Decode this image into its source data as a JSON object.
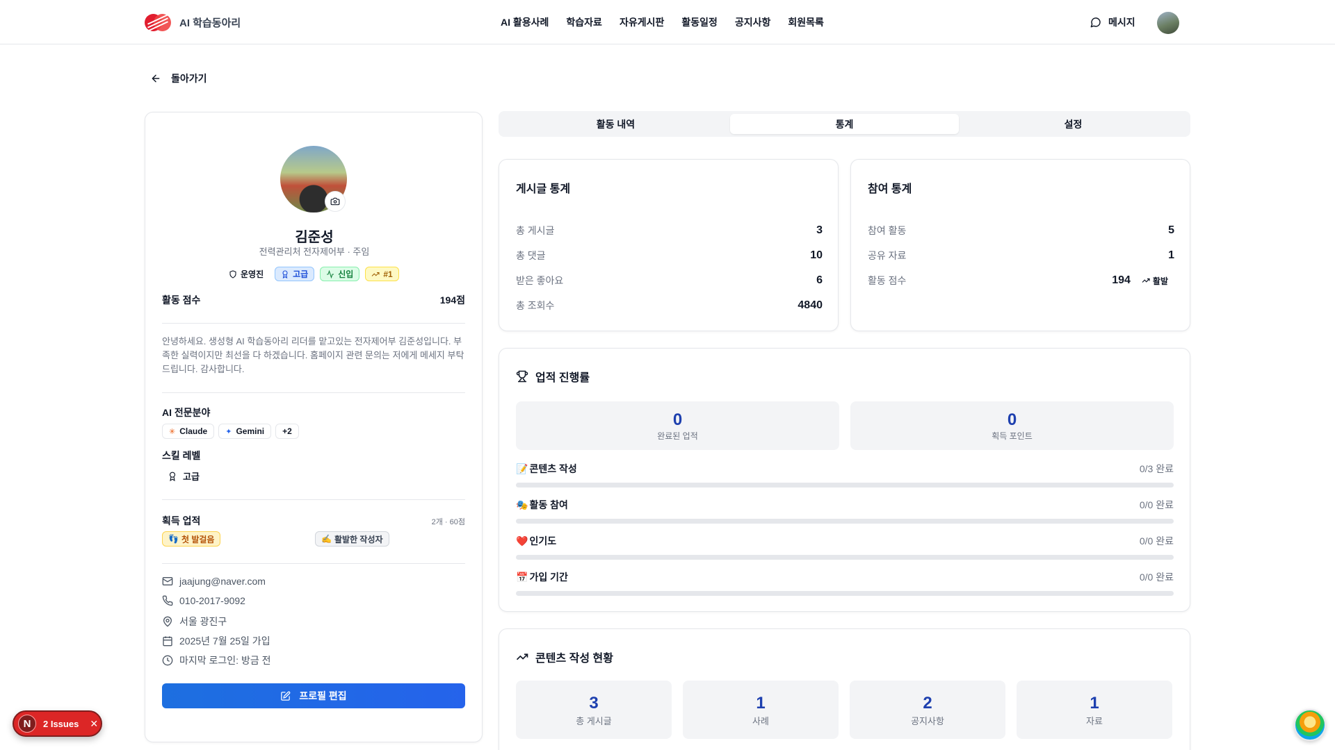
{
  "header": {
    "brand": "AI 학습동아리",
    "nav": [
      "AI 활용사례",
      "학습자료",
      "자유게시판",
      "활동일정",
      "공지사항",
      "회원목록"
    ],
    "message_label": "메시지"
  },
  "back_label": "돌아가기",
  "profile": {
    "name": "김준성",
    "dept": "전력관리처 전자제어부 · 주임",
    "badges": {
      "role": "운영진",
      "level": "고급",
      "new": "신입",
      "rank": "#1"
    },
    "score_label": "활동 점수",
    "score_value": "194점",
    "bio": "안녕하세요. 생성형 AI 학습동아리 리더를 맡고있는 전자제어부 김준성입니다. 부족한 실력이지만 최선을 다 하겠습니다. 홈페이지 관련 문의는 저에게 메세지 부탁드립니다. 감사합니다.",
    "ai_title": "AI 전문분야",
    "ai_chips": [
      "Claude",
      "Gemini",
      "+2"
    ],
    "skill_title": "스킬 레벨",
    "skill_value": "고급",
    "achievements_title": "획득 업적",
    "achievements_meta": "2개 · 60점",
    "achievements": [
      "첫 발걸음",
      "활발한 작성자"
    ],
    "contact": {
      "email": "jaajung@naver.com",
      "phone": "010-2017-9092",
      "location": "서울 광진구",
      "joined": "2025년 7월 25일 가입",
      "last_login": "마지막 로그인: 방금 전"
    },
    "edit_label": "프로필 편집"
  },
  "tabs": [
    "활동 내역",
    "통계",
    "설정"
  ],
  "active_tab": "통계",
  "post_stats": {
    "title": "게시글 통계",
    "rows": [
      {
        "label": "총 게시글",
        "value": "3"
      },
      {
        "label": "총 댓글",
        "value": "10"
      },
      {
        "label": "받은 좋아요",
        "value": "6"
      },
      {
        "label": "총 조회수",
        "value": "4840"
      }
    ]
  },
  "participation_stats": {
    "title": "참여 통계",
    "rows": [
      {
        "label": "참여 활동",
        "value": "5"
      },
      {
        "label": "공유 자료",
        "value": "1"
      },
      {
        "label": "활동 점수",
        "value": "194"
      }
    ],
    "trend_label": "활발"
  },
  "achievement_progress": {
    "title": "업적 진행률",
    "completed_value": "0",
    "completed_label": "완료된 업적",
    "points_value": "0",
    "points_label": "획득 포인트",
    "categories": [
      {
        "emoji": "📝",
        "name": "콘텐츠 작성",
        "status": "0/3 완료",
        "progress": 0
      },
      {
        "emoji": "🎭",
        "name": "활동 참여",
        "status": "0/0 완료",
        "progress": 0
      },
      {
        "emoji": "❤️",
        "name": "인기도",
        "status": "0/0 완료",
        "progress": 0
      },
      {
        "emoji": "📅",
        "name": "가입 기간",
        "status": "0/0 완료",
        "progress": 0
      }
    ]
  },
  "content_status": {
    "title": "콘텐츠 작성 현황",
    "boxes": [
      {
        "value": "3",
        "label": "총 게시글"
      },
      {
        "value": "1",
        "label": "사례"
      },
      {
        "value": "2",
        "label": "공지사항"
      },
      {
        "value": "1",
        "label": "자료"
      }
    ]
  },
  "issues_widget": {
    "logo": "N",
    "label": "2 Issues"
  },
  "colors": {
    "primary": "#2563eb",
    "brand_red": "#e11d2e",
    "stat_blue": "#1e40af"
  }
}
